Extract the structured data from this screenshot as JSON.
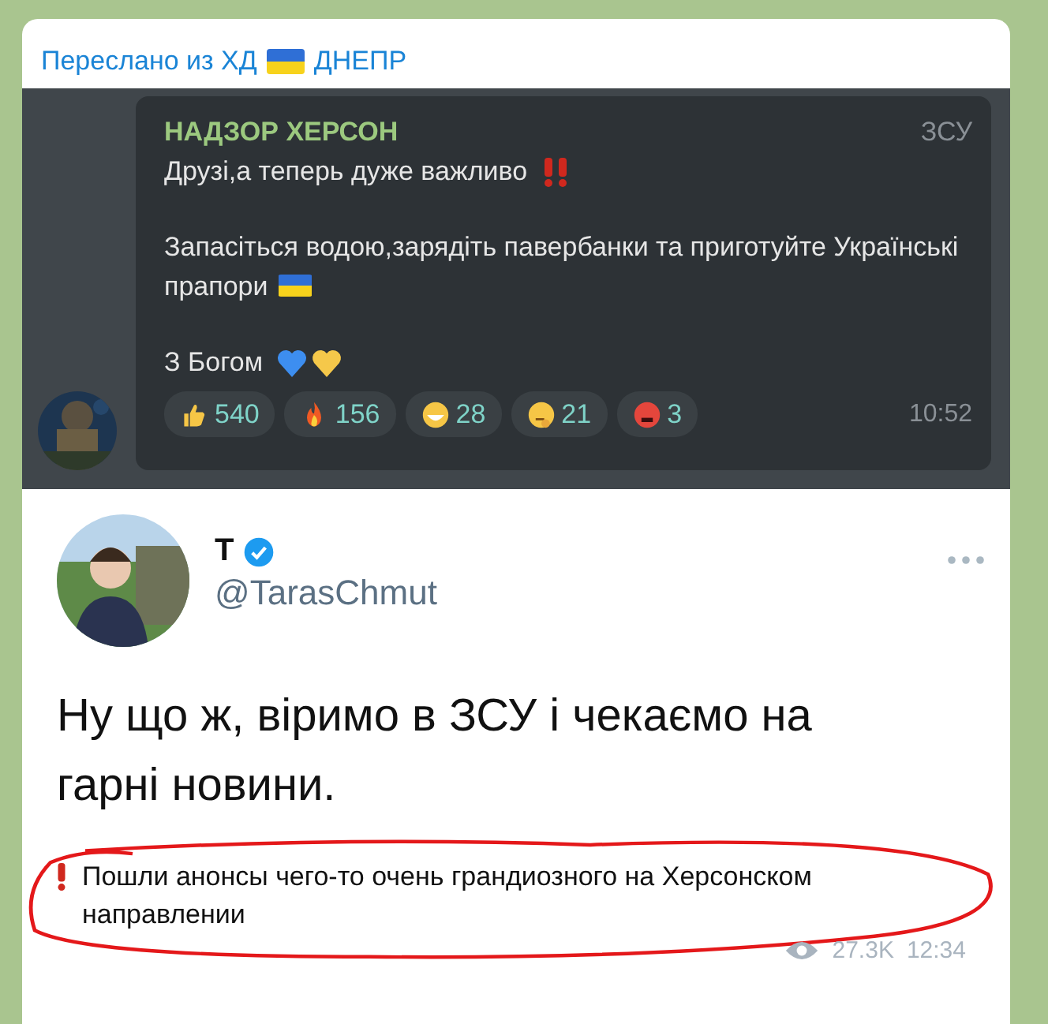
{
  "forward": {
    "label": "Переслано из ХД",
    "source": "ДНЕПР"
  },
  "post": {
    "channel": "НАДЗОР ХЕРСОН",
    "signature": "ЗСУ",
    "line_1": "Друзі,а теперь дуже важливо",
    "line_2": "Запасіться водою,зарядіть павербанки та приготуйте Українські прапори",
    "line_3": "З Богом",
    "time": "10:52",
    "reactions": [
      {
        "kind": "thumbs-up",
        "count": "540"
      },
      {
        "kind": "fire",
        "count": "156"
      },
      {
        "kind": "grin",
        "count": "28"
      },
      {
        "kind": "thinking",
        "count": "21"
      },
      {
        "kind": "angry",
        "count": "3"
      }
    ]
  },
  "tweet": {
    "name": "T",
    "verified": true,
    "handle": "@TarasChmut",
    "text": "Ну що ж, віримо в ЗСУ і чекаємо на гарні новини."
  },
  "caption": "Пошли анонсы чего-то очень грандиозного на Херсонском направлении",
  "views": "27.3K",
  "time": "12:34"
}
